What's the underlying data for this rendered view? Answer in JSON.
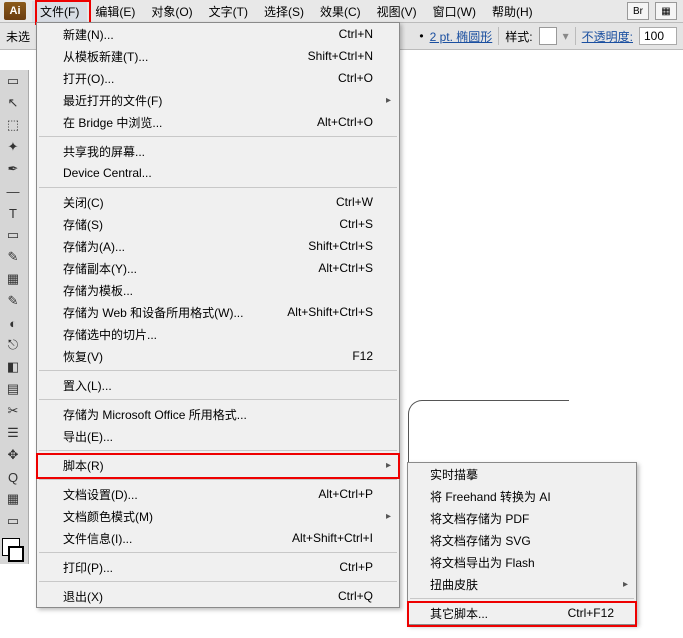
{
  "appicon": "Ai",
  "menubar": [
    "文件(F)",
    "编辑(E)",
    "对象(O)",
    "文字(T)",
    "选择(S)",
    "效果(C)",
    "视图(V)",
    "窗口(W)",
    "帮助(H)"
  ],
  "bricon": "Br",
  "aiicon_glyph": "▦",
  "toolbar": {
    "unsaved": "未选",
    "stroke_label": "2 pt. 椭圆形",
    "style_label": "样式:",
    "opacity_label": "不透明度:",
    "opacity_value": "100"
  },
  "file_menu": [
    {
      "label": "新建(N)...",
      "sc": "Ctrl+N"
    },
    {
      "label": "从模板新建(T)...",
      "sc": "Shift+Ctrl+N"
    },
    {
      "label": "打开(O)...",
      "sc": "Ctrl+O"
    },
    {
      "label": "最近打开的文件(F)",
      "sub": true
    },
    {
      "label": "在 Bridge 中浏览...",
      "sc": "Alt+Ctrl+O"
    },
    {
      "sep": true
    },
    {
      "label": "共享我的屏幕..."
    },
    {
      "label": "Device Central..."
    },
    {
      "sep": true
    },
    {
      "label": "关闭(C)",
      "sc": "Ctrl+W"
    },
    {
      "label": "存储(S)",
      "sc": "Ctrl+S"
    },
    {
      "label": "存储为(A)...",
      "sc": "Shift+Ctrl+S"
    },
    {
      "label": "存储副本(Y)...",
      "sc": "Alt+Ctrl+S"
    },
    {
      "label": "存储为模板..."
    },
    {
      "label": "存储为 Web 和设备所用格式(W)...",
      "sc": "Alt+Shift+Ctrl+S"
    },
    {
      "label": "存储选中的切片..."
    },
    {
      "label": "恢复(V)",
      "sc": "F12"
    },
    {
      "sep": true
    },
    {
      "label": "置入(L)..."
    },
    {
      "sep": true
    },
    {
      "label": "存储为 Microsoft Office 所用格式..."
    },
    {
      "label": "导出(E)..."
    },
    {
      "sep": true
    },
    {
      "label": "脚本(R)",
      "sub": true,
      "id": "scripts-row"
    },
    {
      "sep": true
    },
    {
      "label": "文档设置(D)...",
      "sc": "Alt+Ctrl+P"
    },
    {
      "label": "文档颜色模式(M)",
      "sub": true
    },
    {
      "label": "文件信息(I)...",
      "sc": "Alt+Shift+Ctrl+I"
    },
    {
      "sep": true
    },
    {
      "label": "打印(P)...",
      "sc": "Ctrl+P"
    },
    {
      "sep": true
    },
    {
      "label": "退出(X)",
      "sc": "Ctrl+Q"
    }
  ],
  "scripts_submenu": [
    {
      "label": "实时描摹"
    },
    {
      "label": "将 Freehand 转换为 AI"
    },
    {
      "label": "将文档存储为 PDF"
    },
    {
      "label": "将文档存储为 SVG"
    },
    {
      "label": "将文档导出为 Flash"
    },
    {
      "label": "扭曲皮肤",
      "sub": true
    },
    {
      "sep": true
    },
    {
      "label": "其它脚本...",
      "sc": "Ctrl+F12",
      "id": "other-scripts-row"
    }
  ],
  "tools": [
    "▭",
    "↖",
    "⬚",
    "✦",
    "✒",
    "—",
    "T",
    "▭",
    "✎",
    "▦",
    "✎",
    "◐",
    "⎋",
    "◧",
    "▤",
    "✂",
    "☰",
    "✥",
    "Q",
    "▦",
    "▭"
  ]
}
